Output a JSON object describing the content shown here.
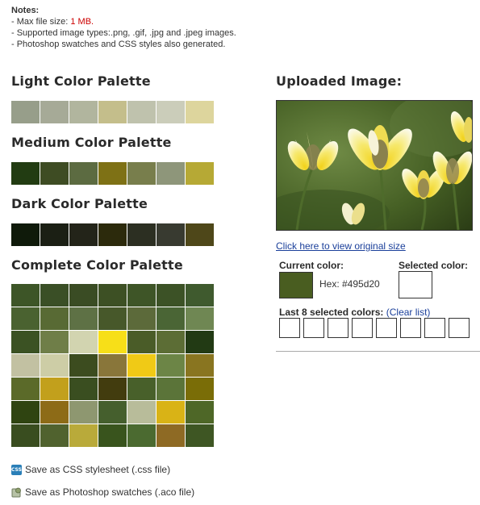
{
  "notes": {
    "title": "Notes:",
    "line1_prefix": "- Max file size: ",
    "line1_value": "1 MB.",
    "line2": "- Supported image types:.png, .gif, .jpg and .jpeg images.",
    "line3": "- Photoshop swatches and CSS styles also generated."
  },
  "light": {
    "title": "Light Color Palette",
    "colors": [
      "#979e8a",
      "#a6aa97",
      "#b1b59e",
      "#c4be8b",
      "#bfc2ad",
      "#cbcdba",
      "#ddd59d"
    ]
  },
  "medium": {
    "title": "Medium Color Palette",
    "colors": [
      "#223c12",
      "#3e4c23",
      "#5c6b41",
      "#7e7115",
      "#787e4c",
      "#8e967a",
      "#b6a935"
    ]
  },
  "dark": {
    "title": "Dark Color Palette",
    "colors": [
      "#0f1a0a",
      "#1b1f14",
      "#232419",
      "#2c2a0c",
      "#2c2f22",
      "#383a30",
      "#4e4719"
    ]
  },
  "complete": {
    "title": "Complete Color Palette",
    "colors": [
      "#3d5527",
      "#3a4f26",
      "#3a4c24",
      "#3d5024",
      "#3e5527",
      "#3c5226",
      "#3f5a2e",
      "#4a6230",
      "#586a34",
      "#5e7145",
      "#47582a",
      "#5c6a3a",
      "#4a6535",
      "#6f8753",
      "#3b5223",
      "#6f7e48",
      "#d2d4b0",
      "#f7df18",
      "#4a5c28",
      "#5c6d35",
      "#223a14",
      "#c2c1a2",
      "#cdcda6",
      "#3c4c1f",
      "#89763a",
      "#f0ca16",
      "#6c8546",
      "#897520",
      "#5b6a29",
      "#c2a01c",
      "#3a4e20",
      "#423c0e",
      "#48602a",
      "#5b7439",
      "#7a6d07",
      "#2f4411",
      "#8d6b17",
      "#8e9770",
      "#455f2d",
      "#b8bc9a",
      "#d9b316",
      "#4e6727",
      "#394d1f",
      "#50622e",
      "#b9aa3a",
      "#39541d",
      "#4b6a30",
      "#8e6a24",
      "#3e5623"
    ]
  },
  "save": {
    "css_label": "Save as CSS stylesheet (.css file)",
    "css_icon_text": "CSS",
    "aco_label": "Save as Photoshop swatches (.aco file)"
  },
  "uploaded": {
    "title": "Uploaded Image:",
    "view_link": "Click here to view original size"
  },
  "current": {
    "label": "Current color:",
    "hex_text": "Hex: #495d20",
    "color": "#495d20"
  },
  "selected": {
    "label": "Selected color:"
  },
  "last8": {
    "label": "Last 8 selected colors:",
    "clear": "(Clear list)"
  }
}
